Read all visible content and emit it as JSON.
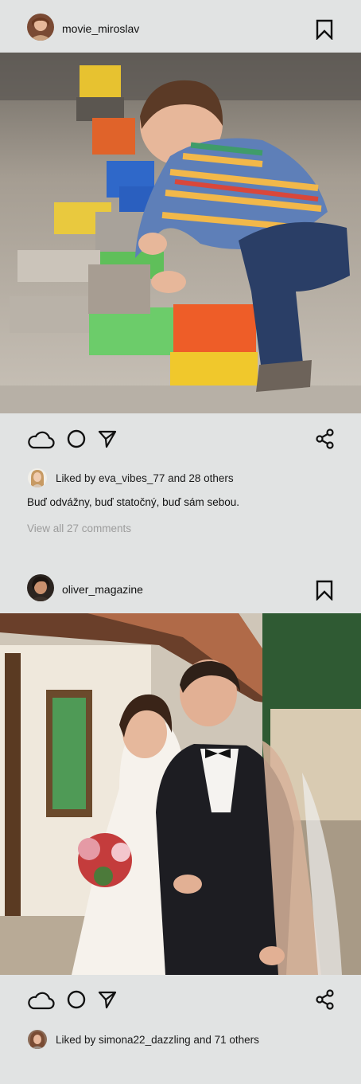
{
  "colors": {
    "background": "#e1e3e3",
    "text": "#111111",
    "muted_text": "#9c9c9c",
    "icon_stroke": "#111111"
  },
  "posts": [
    {
      "username": "movie_miroslav",
      "avatar_icon": "avatar",
      "bookmark_icon": "bookmark-icon",
      "photo_description_icon": "photo",
      "actions": {
        "like_icon": "cloud-icon",
        "comment_icon": "circle-icon",
        "send_icon": "send-icon",
        "share_icon": "share-icon"
      },
      "likes_text": "Liked by eva_vibes_77 and 28 others",
      "caption": "Buď odvážny, buď statočný, buď sám sebou.",
      "comments_link": "View all 27 comments"
    },
    {
      "username": "oliver_magazine",
      "avatar_icon": "avatar",
      "bookmark_icon": "bookmark-icon",
      "photo_description_icon": "photo",
      "actions": {
        "like_icon": "cloud-icon",
        "comment_icon": "circle-icon",
        "send_icon": "send-icon",
        "share_icon": "share-icon"
      },
      "likes_text": "Liked by simona22_dazzling and 71 others"
    }
  ]
}
